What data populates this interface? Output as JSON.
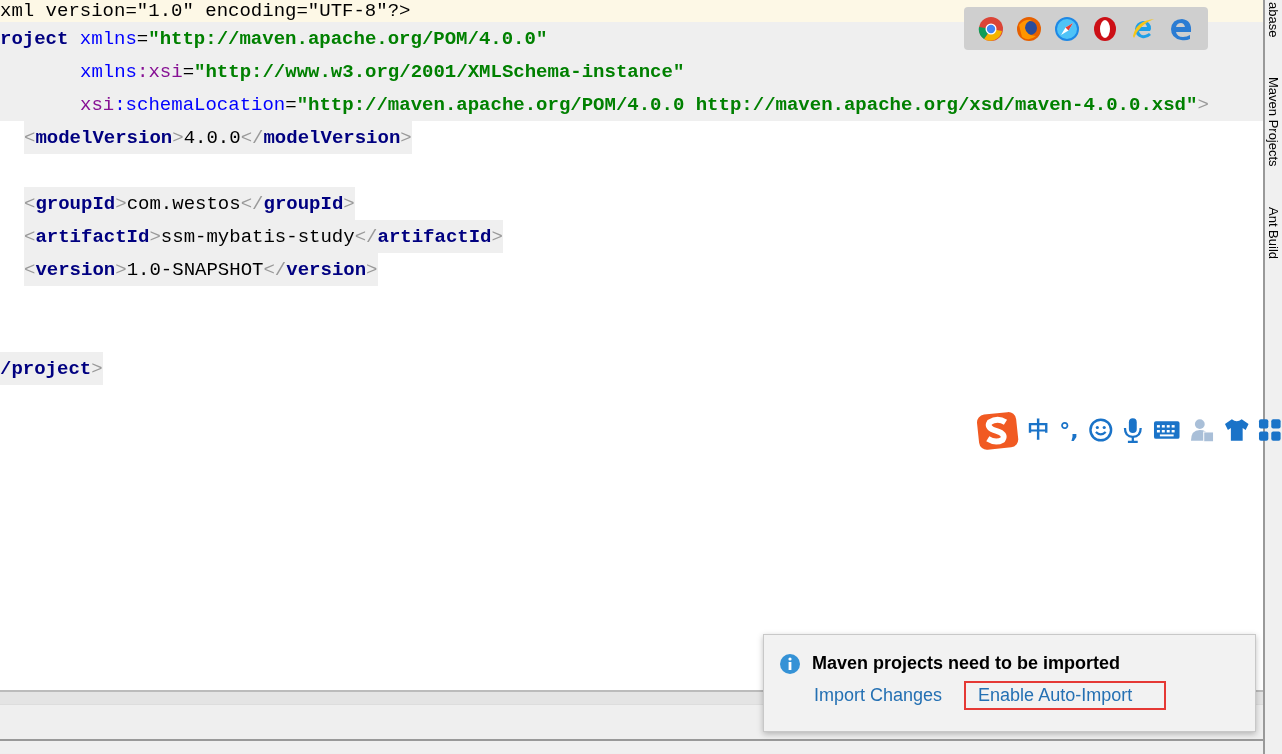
{
  "editor": {
    "lines": [
      {
        "kind": "current",
        "tokens": [
          {
            "kind": "text",
            "text": "xml version=\"1.0\" encoding=\"UTF-8\"?>"
          }
        ]
      },
      {
        "kind": "block-root",
        "tokens": [
          {
            "kind": "tag",
            "text": "roject"
          },
          {
            "kind": "attr",
            "text": " xmlns"
          },
          {
            "kind": "text",
            "text": "="
          },
          {
            "kind": "value",
            "text": "\"http://maven.apache.org/POM/4.0.0\""
          }
        ]
      },
      {
        "kind": "continuation",
        "tokens": [
          {
            "kind": "attr",
            "text": "xmlns"
          },
          {
            "kind": "ns",
            "text": ":xsi"
          },
          {
            "kind": "text",
            "text": "="
          },
          {
            "kind": "value",
            "text": "\"http://www.w3.org/2001/XMLSchema-instance\""
          }
        ]
      },
      {
        "kind": "continuation",
        "tokens": [
          {
            "kind": "ns",
            "text": "xsi"
          },
          {
            "kind": "attr",
            "text": ":schemaLocation"
          },
          {
            "kind": "text",
            "text": "="
          },
          {
            "kind": "value",
            "text": "\"http://maven.apache.org/POM/4.0.0 http://maven.apache.org/xsd/maven-4.0.0.xsd\""
          },
          {
            "kind": "bracket",
            "text": ">"
          }
        ]
      },
      {
        "kind": "child",
        "tokens": [
          {
            "kind": "bracket",
            "text": "<"
          },
          {
            "kind": "tag",
            "text": "modelVersion"
          },
          {
            "kind": "bracket",
            "text": ">"
          },
          {
            "kind": "text",
            "text": "4.0.0"
          },
          {
            "kind": "bracket",
            "text": "</"
          },
          {
            "kind": "tag",
            "text": "modelVersion"
          },
          {
            "kind": "bracket",
            "text": ">"
          }
        ]
      },
      {
        "kind": "blank"
      },
      {
        "kind": "child",
        "tokens": [
          {
            "kind": "bracket",
            "text": "<"
          },
          {
            "kind": "tag",
            "text": "groupId"
          },
          {
            "kind": "bracket",
            "text": ">"
          },
          {
            "kind": "text",
            "text": "com.westos"
          },
          {
            "kind": "bracket",
            "text": "</"
          },
          {
            "kind": "tag",
            "text": "groupId"
          },
          {
            "kind": "bracket",
            "text": ">"
          }
        ]
      },
      {
        "kind": "child",
        "tokens": [
          {
            "kind": "bracket",
            "text": "<"
          },
          {
            "kind": "tag",
            "text": "artifactId"
          },
          {
            "kind": "bracket",
            "text": ">"
          },
          {
            "kind": "text",
            "text": "ssm-mybatis-study"
          },
          {
            "kind": "bracket",
            "text": "</"
          },
          {
            "kind": "tag",
            "text": "artifactId"
          },
          {
            "kind": "bracket",
            "text": ">"
          }
        ]
      },
      {
        "kind": "child",
        "tokens": [
          {
            "kind": "bracket",
            "text": "<"
          },
          {
            "kind": "tag",
            "text": "version"
          },
          {
            "kind": "bracket",
            "text": ">"
          },
          {
            "kind": "text",
            "text": "1.0-SNAPSHOT"
          },
          {
            "kind": "bracket",
            "text": "</"
          },
          {
            "kind": "tag",
            "text": "version"
          },
          {
            "kind": "bracket",
            "text": ">"
          }
        ]
      },
      {
        "kind": "blank"
      },
      {
        "kind": "blank"
      },
      {
        "kind": "root",
        "tokens": [
          {
            "kind": "tag",
            "text": "/project"
          },
          {
            "kind": "bracket",
            "text": ">"
          }
        ]
      }
    ]
  },
  "browser_icons": [
    {
      "kind": "chrome"
    },
    {
      "kind": "firefox"
    },
    {
      "kind": "safari"
    },
    {
      "kind": "opera"
    },
    {
      "kind": "ie"
    },
    {
      "kind": "edge"
    }
  ],
  "side_tabs": [
    {
      "label": "abase"
    },
    {
      "label": "Maven Projects"
    },
    {
      "label": "Ant Build"
    }
  ],
  "ime_toolbar": {
    "items": [
      {
        "kind": "logo"
      },
      {
        "kind": "text",
        "text": "中"
      },
      {
        "kind": "text",
        "text": "°,"
      },
      {
        "kind": "smiley"
      },
      {
        "kind": "mic"
      },
      {
        "kind": "keyboard"
      },
      {
        "kind": "user"
      },
      {
        "kind": "shirt"
      },
      {
        "kind": "grid"
      }
    ]
  },
  "notification": {
    "title": "Maven projects need to be imported",
    "links": [
      {
        "label": "Import Changes",
        "highlighted": false
      },
      {
        "label": "Enable Auto-Import",
        "highlighted": true
      }
    ]
  }
}
